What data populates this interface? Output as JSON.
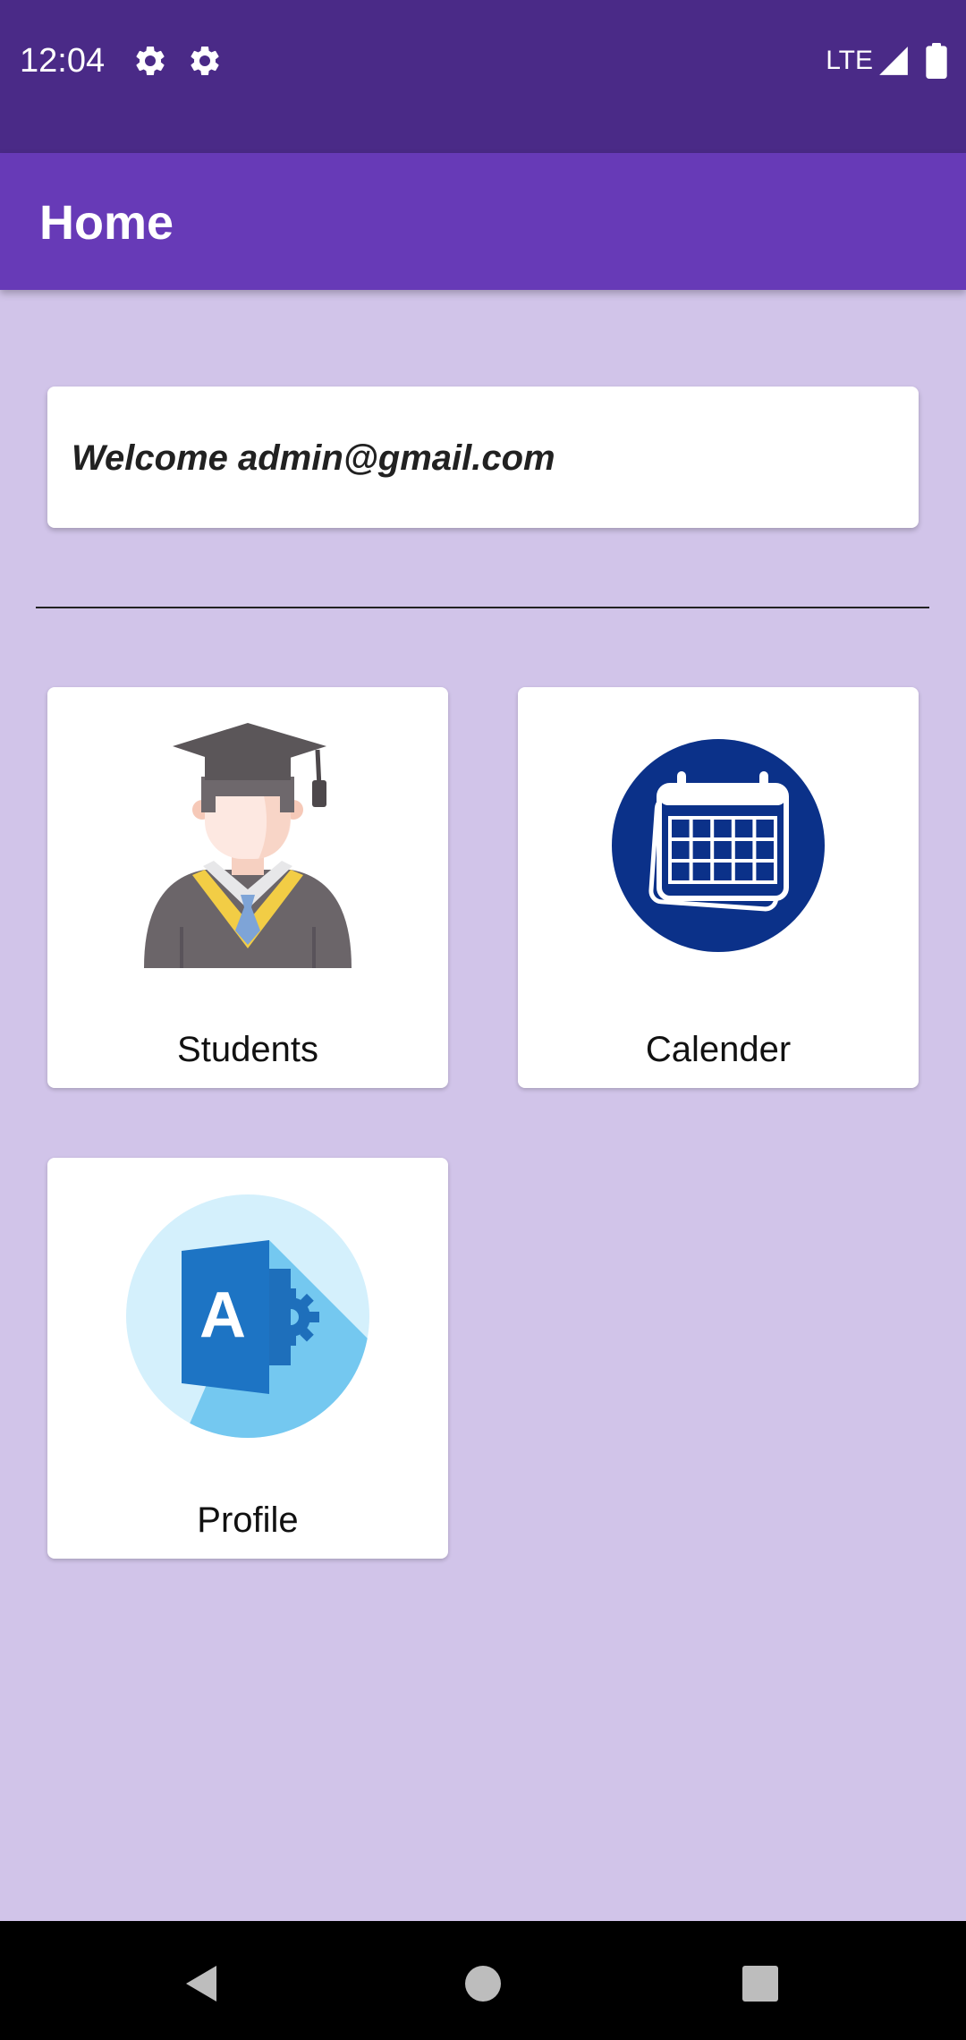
{
  "status_bar": {
    "time": "12:04",
    "network": "LTE",
    "icons": [
      "gear-icon",
      "gear-icon",
      "signal-icon",
      "battery-icon"
    ]
  },
  "app_bar": {
    "title": "Home"
  },
  "welcome": {
    "text": "Welcome admin@gmail.com"
  },
  "tiles": [
    {
      "label": "Students",
      "icon": "graduate-icon"
    },
    {
      "label": "Calender",
      "icon": "calendar-icon"
    },
    {
      "label": "Profile",
      "icon": "profile-app-icon"
    }
  ],
  "nav": {
    "icons": [
      "back-icon",
      "home-icon",
      "recents-icon"
    ]
  },
  "colors": {
    "status_bar": "#4a2a87",
    "app_bar": "#673ab7",
    "background": "#d1c4e9",
    "calendar_blue": "#0b3189"
  }
}
